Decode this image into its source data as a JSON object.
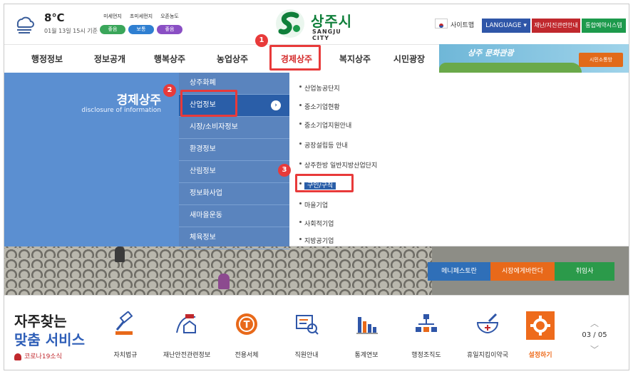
{
  "weather": {
    "temp": "8℃",
    "date": "01월 13일 15시 기준",
    "air": [
      {
        "label": "미세먼지",
        "status": "좋음",
        "color": "#3aa65a"
      },
      {
        "label": "초미세먼지",
        "status": "보통",
        "color": "#2f7fd1"
      },
      {
        "label": "오존농도",
        "status": "좋음",
        "color": "#8a4fc4"
      }
    ]
  },
  "logo": {
    "ko": "상주시",
    "en": "SANGJU CITY"
  },
  "util": {
    "sitemap": "사이트맵",
    "language": "LANGUAGE ▾",
    "disaster": "재난/지진관련안내",
    "reserve": "통합예약시스템"
  },
  "gnb": [
    "행정정보",
    "정보공개",
    "행복상주",
    "농업상주",
    "경제상주",
    "복지상주",
    "시민광장"
  ],
  "banner": {
    "title": "상주 문화관광",
    "button": "시민소통방"
  },
  "lnb": {
    "title": "경제상주",
    "sub": "disclosure of information"
  },
  "depth2": [
    "상주화폐",
    "산업정보",
    "시장/소비자정보",
    "환경정보",
    "산림정보",
    "정보화사업",
    "새마을운동",
    "체육정보"
  ],
  "depth3": [
    "산업농공단지",
    "중소기업현황",
    "중소기업지원안내",
    "공장설립등 안내",
    "상주한방 일반지방산업단지",
    "구인/구직",
    "마을기업",
    "사회적기업",
    "지방공기업"
  ],
  "right_buttons": [
    {
      "label": "메니페스토란",
      "color": "#2f6fb8"
    },
    {
      "label": "시장에게바란다",
      "color": "#e8691a"
    },
    {
      "label": "취임사",
      "color": "#2b9a4a"
    }
  ],
  "badges": [
    "1",
    "2",
    "3"
  ],
  "quick": {
    "title1": "자주찾는",
    "title2": "맞춤 서비스",
    "covid": "코로나19소식",
    "items": [
      "자치법규",
      "재난안전관련정보",
      "전용서체",
      "직원안내",
      "통계연보",
      "행정조직도",
      "휴일지킴이약국",
      "설정하기"
    ],
    "pager": "03 / 05"
  }
}
